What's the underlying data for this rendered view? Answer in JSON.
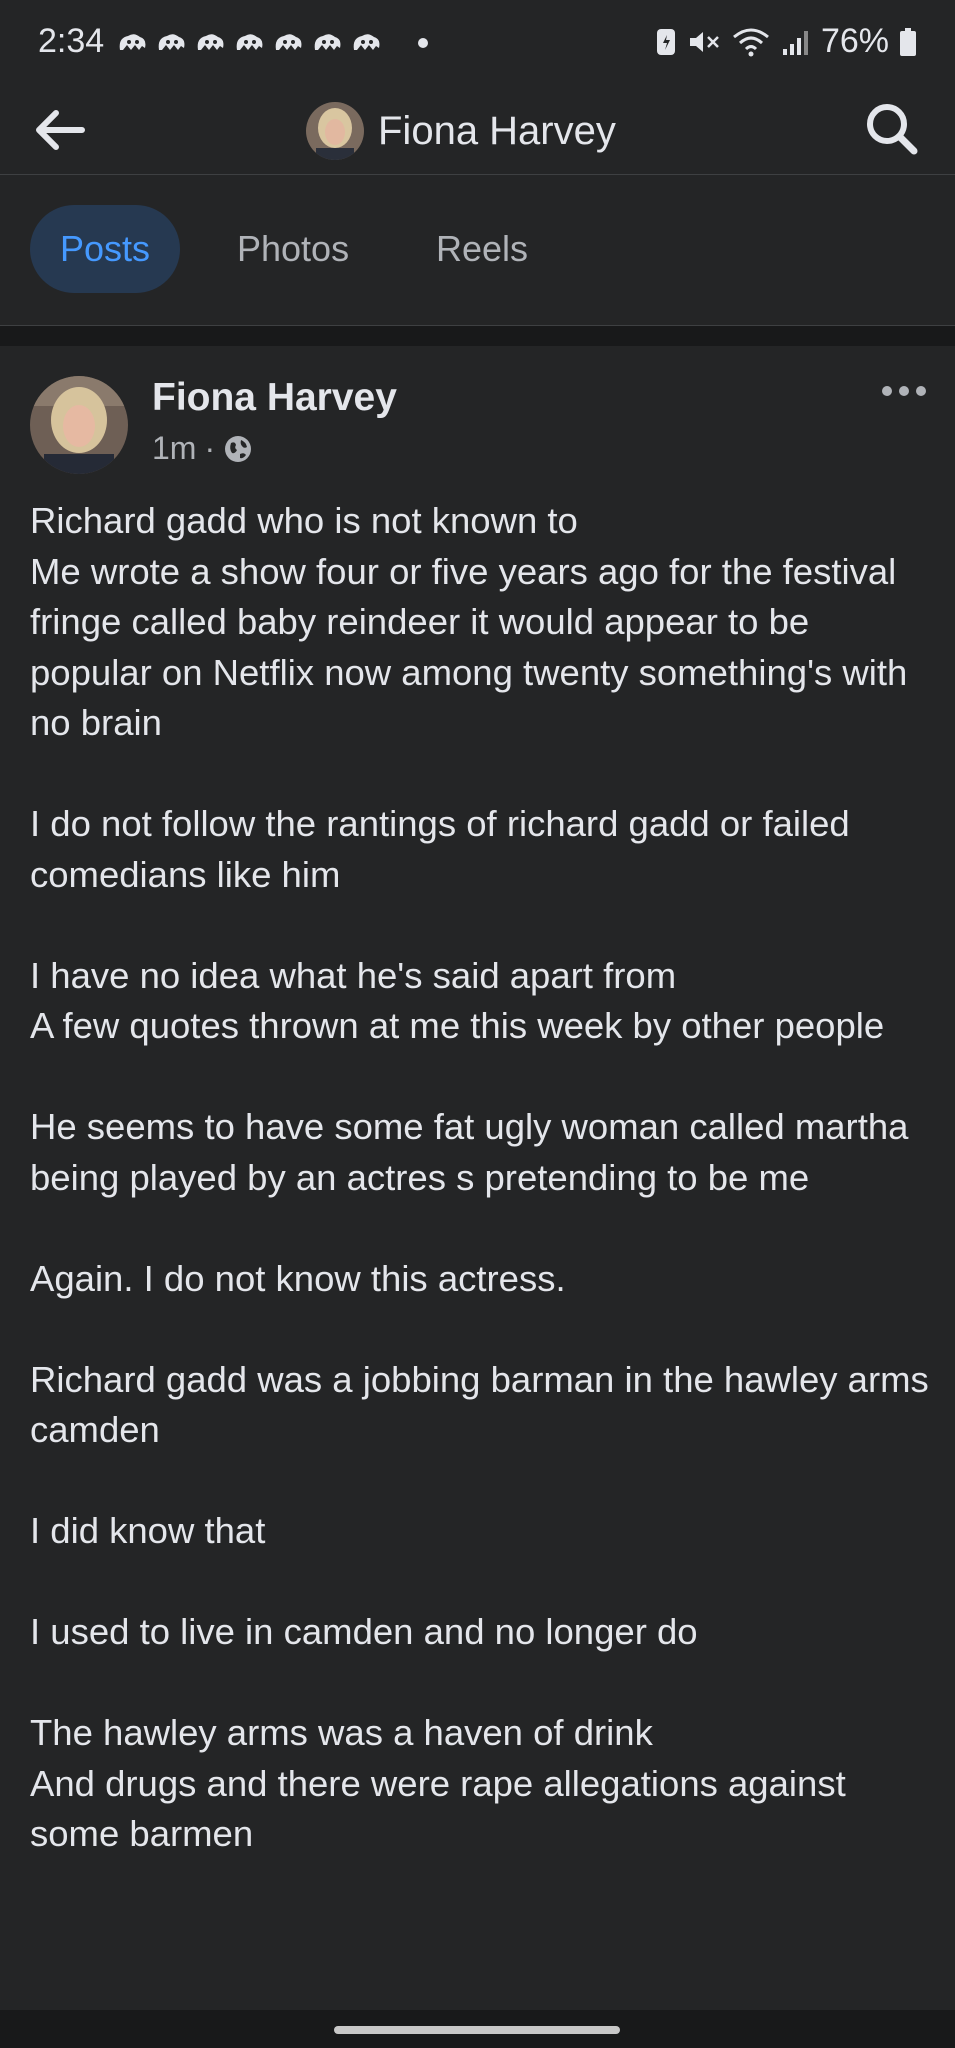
{
  "status_bar": {
    "time": "2:34",
    "battery": "76%",
    "notification_icons": [
      "app-notification-icon",
      "app-notification-icon",
      "app-notification-icon",
      "app-notification-icon",
      "app-notification-icon",
      "app-notification-icon",
      "app-notification-icon"
    ]
  },
  "header": {
    "title": "Fiona Harvey"
  },
  "tabs": [
    {
      "label": "Posts",
      "active": true
    },
    {
      "label": "Photos",
      "active": false
    },
    {
      "label": "Reels",
      "active": false
    }
  ],
  "post": {
    "author": "Fiona Harvey",
    "time": "1m",
    "separator": "·",
    "paragraphs": [
      "Richard gadd who is not known to\nMe wrote a show four or five years ago for the festival fringe called baby reindeer it would appear to be popular on Netflix now among twenty something's with no brain",
      "I do not follow the rantings of richard gadd or failed comedians like him",
      "I have no idea what he's said apart from\nA few quotes thrown at me this week by other people",
      "He seems to have some fat ugly woman called martha being played by an actres s pretending to be me",
      "Again. I do not know this actress.",
      "Richard gadd was a jobbing barman in the hawley arms camden",
      "I did know that",
      "I used to live in camden and no longer do",
      "The hawley arms was a haven of drink\nAnd drugs and there were rape allegations against some barmen"
    ]
  },
  "colors": {
    "background": "#242526",
    "accent": "#4599ff",
    "active_tab_bg": "#263951",
    "text": "#e4e6eb",
    "secondary_text": "#b0b3b8"
  }
}
